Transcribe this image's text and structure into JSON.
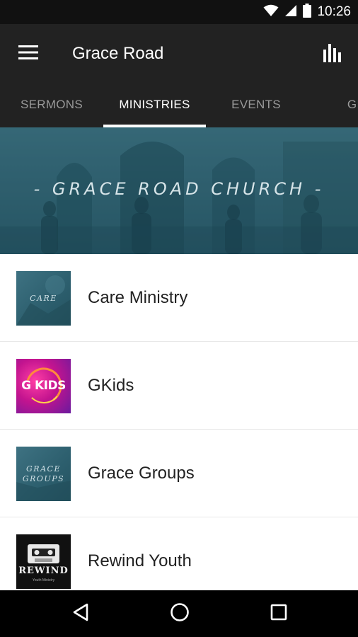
{
  "status_bar": {
    "time": "10:26",
    "icons": [
      "wifi-icon",
      "signal-icon",
      "battery-icon"
    ]
  },
  "app_bar": {
    "title": "Grace Road",
    "menu_icon": "hamburger-menu-icon",
    "action_icon": "bar-chart-icon"
  },
  "tabs": [
    {
      "label": "SERMONS",
      "active": false
    },
    {
      "label": "MINISTRIES",
      "active": true
    },
    {
      "label": "EVENTS",
      "active": false
    },
    {
      "label": "GIV",
      "active": false
    }
  ],
  "banner": {
    "title": "- GRACE ROAD CHURCH -"
  },
  "list": [
    {
      "label": "Care Ministry",
      "thumb_text": "CARE"
    },
    {
      "label": "GKids",
      "thumb_text": "G KIDS"
    },
    {
      "label": "Grace Groups",
      "thumb_text_line1": "GRACE",
      "thumb_text_line2": "GROUPS"
    },
    {
      "label": "Rewind Youth",
      "thumb_text": "REWIND",
      "thumb_subtext": "Youth Ministry"
    }
  ],
  "nav_bar": {
    "icons": [
      "back-triangle-icon",
      "home-circle-icon",
      "recents-square-icon"
    ]
  },
  "colors": {
    "app_bar": "#222222",
    "status_bar": "#111111",
    "banner_teal": "#2f5f6e",
    "accent_indicator": "#ffffff"
  }
}
